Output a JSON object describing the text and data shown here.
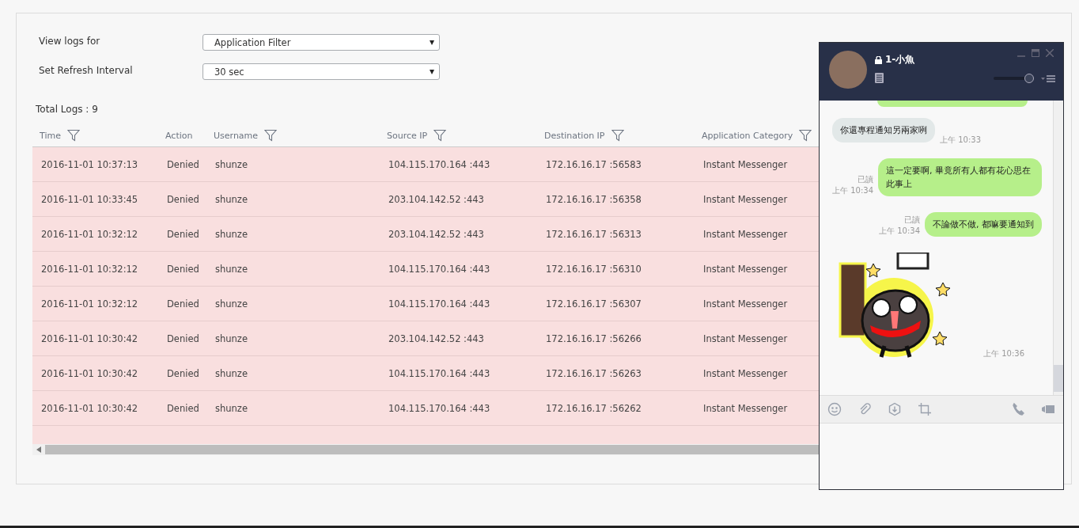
{
  "filters": [
    {
      "label": "View logs for",
      "value": "Application Filter"
    },
    {
      "label": "Set Refresh Interval",
      "value": "30 sec"
    }
  ],
  "total_logs": "Total Logs : 9",
  "table": {
    "columns": [
      {
        "label": "Time",
        "filter": true
      },
      {
        "label": "Action",
        "filter": false
      },
      {
        "label": "Username",
        "filter": true
      },
      {
        "label": "Source IP",
        "filter": true
      },
      {
        "label": "Destination IP",
        "filter": true
      },
      {
        "label": "Application Category",
        "filter": true
      }
    ],
    "rows": [
      [
        "2016-11-01 10:37:13",
        "Denied",
        "shunze",
        "104.115.170.164 :443",
        "172.16.16.17 :56583",
        "Instant Messenger"
      ],
      [
        "2016-11-01 10:33:45",
        "Denied",
        "shunze",
        "203.104.142.52 :443",
        "172.16.16.17 :56358",
        "Instant Messenger"
      ],
      [
        "2016-11-01 10:32:12",
        "Denied",
        "shunze",
        "203.104.142.52 :443",
        "172.16.16.17 :56313",
        "Instant Messenger"
      ],
      [
        "2016-11-01 10:32:12",
        "Denied",
        "shunze",
        "104.115.170.164 :443",
        "172.16.16.17 :56310",
        "Instant Messenger"
      ],
      [
        "2016-11-01 10:32:12",
        "Denied",
        "shunze",
        "104.115.170.164 :443",
        "172.16.16.17 :56307",
        "Instant Messenger"
      ],
      [
        "2016-11-01 10:30:42",
        "Denied",
        "shunze",
        "203.104.142.52 :443",
        "172.16.16.17 :56266",
        "Instant Messenger"
      ],
      [
        "2016-11-01 10:30:42",
        "Denied",
        "shunze",
        "104.115.170.164 :443",
        "172.16.16.17 :56263",
        "Instant Messenger"
      ],
      [
        "2016-11-01 10:30:42",
        "Denied",
        "shunze",
        "104.115.170.164 :443",
        "172.16.16.17 :56262",
        "Instant Messenger"
      ]
    ]
  },
  "chat": {
    "title": "1-小魚",
    "volume": {
      "level": 0.9
    },
    "messages": [
      {
        "kind": "clipped"
      },
      {
        "kind": "incoming",
        "text": "你還專程通知另兩家咧",
        "time": "上午 10:33"
      },
      {
        "kind": "outgoing",
        "text": "這一定要啊, 畢竟所有人都有花心思在此事上",
        "read": "已讀",
        "time": "上午 10:34"
      },
      {
        "kind": "outgoing",
        "text": "不論做不做, 都嘛要通知到",
        "read": "已讀",
        "time": "上午 10:34"
      },
      {
        "kind": "sticker",
        "time": "上午 10:36"
      }
    ]
  }
}
